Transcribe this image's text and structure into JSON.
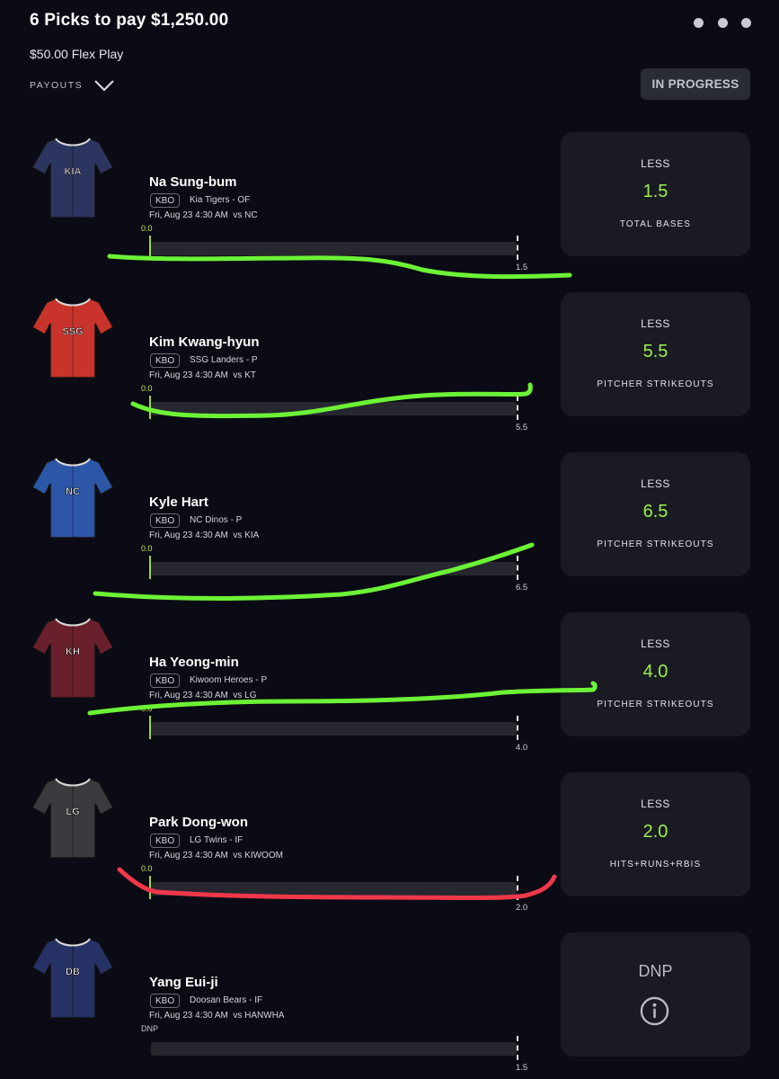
{
  "header": {
    "title": "6 Picks to pay $1,250.00",
    "subtitle": "$50.00 Flex Play",
    "payouts_label": "PAYOUTS",
    "status": "IN PROGRESS"
  },
  "colors": {
    "background": "#0a0b14",
    "card": "#191a22",
    "accent_green": "#9ff04b",
    "scribble_green": "#6cf236",
    "scribble_red": "#f0384a"
  },
  "picks": [
    {
      "player": "Na Sung-bum",
      "league": "KBO",
      "team_position": "Kia Tigers - OF",
      "game": "Fri, Aug 23 4:30 AM  vs NC",
      "start": "0.0",
      "line": "1.5",
      "direction": "LESS",
      "stat": "TOTAL BASES",
      "jersey_text": "KIA",
      "jersey_color": "#2c3560"
    },
    {
      "player": "Kim Kwang-hyun",
      "league": "KBO",
      "team_position": "SSG Landers - P",
      "game": "Fri, Aug 23 4:30 AM  vs KT",
      "start": "0.0",
      "line": "5.5",
      "direction": "LESS",
      "stat": "PITCHER STRIKEOUTS",
      "jersey_text": "SSG",
      "jersey_color": "#c8342b"
    },
    {
      "player": "Kyle Hart",
      "league": "KBO",
      "team_position": "NC Dinos - P",
      "game": "Fri, Aug 23 4:30 AM  vs KIA",
      "start": "0.0",
      "line": "6.5",
      "direction": "LESS",
      "stat": "PITCHER STRIKEOUTS",
      "jersey_text": "NC",
      "jersey_color": "#2c56a6"
    },
    {
      "player": "Ha Yeong-min",
      "league": "KBO",
      "team_position": "Kiwoom Heroes - P",
      "game": "Fri, Aug 23 4:30 AM  vs LG",
      "start": "0.0",
      "line": "4.0",
      "direction": "LESS",
      "stat": "PITCHER STRIKEOUTS",
      "jersey_text": "KH",
      "jersey_color": "#6a1f2c"
    },
    {
      "player": "Park Dong-won",
      "league": "KBO",
      "team_position": "LG Twins - IF",
      "game": "Fri, Aug 23 4:30 AM  vs KIWOOM",
      "start": "0.0",
      "line": "2.0",
      "direction": "LESS",
      "stat": "HITS+RUNS+RBIS",
      "jersey_text": "LG",
      "jersey_color": "#3a3b3f"
    },
    {
      "player": "Yang Eui-ji",
      "league": "KBO",
      "team_position": "Doosan Bears - IF",
      "game": "Fri, Aug 23 4:30 AM  vs HANWHA",
      "start": "DNP",
      "line": "1.5",
      "card_label": "DNP",
      "card_icon": "info-icon",
      "jersey_text": "DB",
      "jersey_color": "#263166"
    }
  ]
}
